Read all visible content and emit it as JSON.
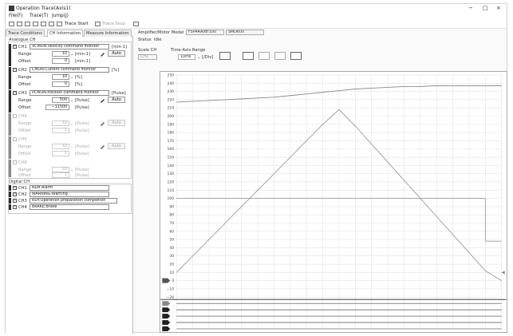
{
  "window": {
    "title": "Operation Trace(Axis1)",
    "controls": [
      "−",
      "□",
      "×"
    ]
  },
  "menu": [
    "File(F)",
    "Trace(T)",
    "Jump(J)"
  ],
  "toolbar": {
    "trace_start": "Trace Start",
    "trace_stop": "Trace Stop"
  },
  "tabs": [
    "Trace Conditions",
    "CH Information",
    "Measure Information"
  ],
  "active_tab": "CH Information",
  "model": {
    "label": "Amplifier/Motor Model",
    "amplifier": "FSP4AA/BF100",
    "motor": "SMD600"
  },
  "status": {
    "label": "Status",
    "value": "Idle"
  },
  "scale_ch": {
    "label": "Scale CH",
    "value": "CH1"
  },
  "time_axis": {
    "label": "Time-Axis Range",
    "value": "10ms",
    "unit": "[/Div]"
  },
  "analogue": {
    "group_label": "Analogue CH",
    "range_label": "Range",
    "offset_label": "Offset",
    "auto_label": "Auto",
    "channels": [
      {
        "name": "CH1",
        "checked": true,
        "signal": "VCMON:Velocity command monitor",
        "unit": "[min-1]",
        "range": "10",
        "offset": "0",
        "color": "#333333"
      },
      {
        "name": "CH2",
        "checked": true,
        "signal": "CMON:Current command monitor",
        "unit": "[%]",
        "range": "10",
        "offset": "0",
        "color": "#333333"
      },
      {
        "name": "CH3",
        "checked": true,
        "signal": "PCMON:Position command monitor",
        "unit": "[Pulse]",
        "range": "500",
        "offset": "−11500",
        "color": "#333333"
      },
      {
        "name": "CH4",
        "checked": false,
        "signal": "",
        "unit": "[Pulse]",
        "range": "10",
        "offset": "1",
        "color": "#aaaaaa"
      },
      {
        "name": "CH5",
        "checked": false,
        "signal": "",
        "unit": "[Pulse]",
        "range": "10",
        "offset": "1",
        "color": "#aaaaaa"
      },
      {
        "name": "CH6",
        "checked": false,
        "signal": "",
        "unit": "[Pulse]",
        "range": "10",
        "offset": "1",
        "color": "#aaaaaa"
      }
    ]
  },
  "digital": {
    "group_label": "Digital CH",
    "channels": [
      {
        "name": "CH1",
        "checked": true,
        "signal": "NLM:Alarm"
      },
      {
        "name": "CH2",
        "checked": true,
        "signal": "WARNING:Warning"
      },
      {
        "name": "CH3",
        "checked": true,
        "signal": "RDY:Operation preparation completion"
      },
      {
        "name": "CH4",
        "checked": true,
        "signal": "BRAKE:Brake"
      }
    ]
  },
  "y_axis_ticks": [
    "250",
    "240",
    "230",
    "220",
    "210",
    "200",
    "190",
    "180",
    "170",
    "160",
    "150",
    "140",
    "130",
    "120",
    "110",
    "100",
    "90",
    "80",
    "70",
    "60",
    "50",
    "40",
    "30",
    "20",
    "10",
    "0",
    "−10",
    "−20"
  ],
  "chart_data": {
    "type": "line",
    "ylim": [
      -20,
      250
    ],
    "x": [
      0,
      1,
      2,
      3,
      4,
      5,
      6,
      7,
      8,
      9,
      10,
      11,
      12,
      13,
      14,
      15,
      16,
      17,
      18,
      19,
      20
    ],
    "series": [
      {
        "values": [
          217,
          218,
          219,
          220,
          221,
          222,
          223,
          225,
          227,
          229,
          231,
          233,
          234,
          235,
          236,
          236,
          237,
          237,
          237,
          237,
          237
        ],
        "color": "#8a8a8a"
      },
      {
        "values": [
          10,
          30,
          50,
          70,
          90,
          110,
          130,
          150,
          170,
          190,
          208,
          188,
          166,
          144,
          122,
          100,
          78,
          56,
          34,
          12,
          0
        ],
        "color": "#9a9a9a"
      },
      {
        "values": [
          100,
          100,
          100,
          100,
          100,
          100,
          100,
          100,
          100,
          100,
          100,
          100,
          100,
          100,
          100,
          100,
          100,
          100,
          100,
          48,
          48
        ],
        "color": "#9a9a9a"
      }
    ]
  }
}
